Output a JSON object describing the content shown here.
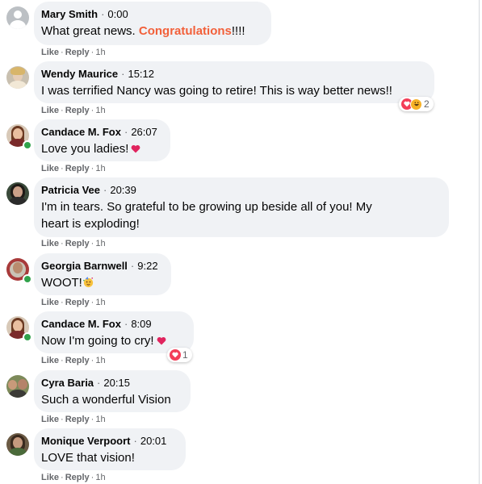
{
  "comments": [
    {
      "author": "Mary Smith",
      "time": "0:00",
      "text_before": "What great news. ",
      "highlight": "Congratulations",
      "text_after": "!!!!",
      "action_like": "Like",
      "action_reply": "Reply",
      "age": "1h"
    },
    {
      "author": "Wendy Maurice",
      "time": "15:12",
      "text": "I was terrified Nancy was going to retire! This is way better news!!",
      "action_like": "Like",
      "action_reply": "Reply",
      "age": "1h",
      "reaction_count": "2",
      "reactions": [
        "love-icon",
        "haha-icon"
      ]
    },
    {
      "author": "Candace M. Fox",
      "time": "26:07",
      "text": "Love you ladies!",
      "emoji": "red-heart-icon",
      "action_like": "Like",
      "action_reply": "Reply",
      "age": "1h",
      "online": true
    },
    {
      "author": "Patricia Vee",
      "time": "20:39",
      "text_line1": "I'm in tears. So grateful to be growing up beside all of you! My",
      "text_line2": "heart is exploding!",
      "action_like": "Like",
      "action_reply": "Reply",
      "age": "1h"
    },
    {
      "author": "Georgia Barnwell",
      "time": "9:22",
      "text": "WOOT!",
      "emoji": "party-face-icon",
      "action_like": "Like",
      "action_reply": "Reply",
      "age": "1h",
      "online": true
    },
    {
      "author": "Candace M. Fox",
      "time": "8:09",
      "text": "Now I'm going to cry!",
      "emoji": "red-heart-icon",
      "action_like": "Like",
      "action_reply": "Reply",
      "age": "1h",
      "online": true,
      "reaction_count": "1",
      "reactions": [
        "love-icon"
      ]
    },
    {
      "author": "Cyra Baria",
      "time": "20:15",
      "text": "Such a wonderful Vision",
      "action_like": "Like",
      "action_reply": "Reply",
      "age": "1h"
    },
    {
      "author": "Monique Verpoort",
      "time": "20:01",
      "text": "LOVE that vision!",
      "action_like": "Like",
      "action_reply": "Reply",
      "age": "1h"
    }
  ],
  "separator": "·",
  "colors": {
    "bubble": "#f0f2f5",
    "highlight": "#f2603a",
    "secondary_text": "#65676b",
    "online": "#31a24c",
    "love": "#f33e58",
    "heart_emoji": "#e0245e"
  }
}
